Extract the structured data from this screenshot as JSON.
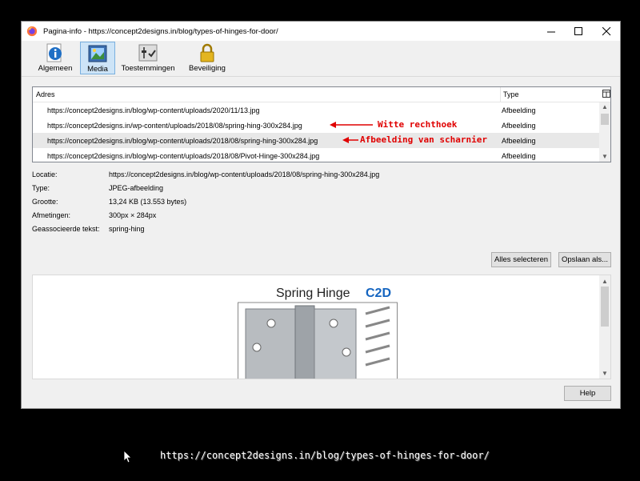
{
  "window": {
    "title": "Pagina-info - https://concept2designs.in/blog/types-of-hinges-for-door/",
    "minimize_icon": "minimize-icon",
    "maximize_icon": "maximize-icon",
    "close_icon": "close-icon"
  },
  "toolbar": {
    "tabs": [
      {
        "label": "Algemeen",
        "icon": "info-icon",
        "active": false
      },
      {
        "label": "Media",
        "icon": "media-icon",
        "active": true
      },
      {
        "label": "Toestemmingen",
        "icon": "permissions-icon",
        "active": false
      },
      {
        "label": "Beveiliging",
        "icon": "lock-icon",
        "active": false
      }
    ]
  },
  "media_list": {
    "col_address": "Adres",
    "col_type": "Type",
    "rows": [
      {
        "address": "https://concept2designs.in/blog/wp-content/uploads/2020/11/13.jpg",
        "type": "Afbeelding",
        "selected": false
      },
      {
        "address": "https://concept2designs.in/wp-content/uploads/2018/08/spring-hing-300x284.jpg",
        "type": "Afbeelding",
        "selected": false
      },
      {
        "address": "https://concept2designs.in/blog/wp-content/uploads/2018/08/spring-hing-300x284.jpg",
        "type": "Afbeelding",
        "selected": true
      },
      {
        "address": "https://concept2designs.in/blog/wp-content/uploads/2018/08/Pivot-Hinge-300x284.jpg",
        "type": "Afbeelding",
        "selected": false
      }
    ]
  },
  "annotations": {
    "a1": "Witte rechthoek",
    "a2": "Afbeelding van scharnier",
    "color": "#e00000"
  },
  "details": [
    {
      "key": "Locatie:",
      "value": "https://concept2designs.in/blog/wp-content/uploads/2018/08/spring-hing-300x284.jpg"
    },
    {
      "key": "Type:",
      "value": "JPEG-afbeelding"
    },
    {
      "key": "Grootte:",
      "value": "13,24 KB (13.553 bytes)"
    },
    {
      "key": "Afmetingen:",
      "value": "300px × 284px"
    },
    {
      "key": "Geassocieerde tekst:",
      "value": "spring-hing"
    }
  ],
  "buttons": {
    "select_all": "Alles selecteren",
    "save_as": "Opslaan als...",
    "help": "Help"
  },
  "preview": {
    "image_title": "Spring Hinge",
    "logo_text": "C2D"
  },
  "footer_url": "https://concept2designs.in/blog/types-of-hinges-for-door/"
}
